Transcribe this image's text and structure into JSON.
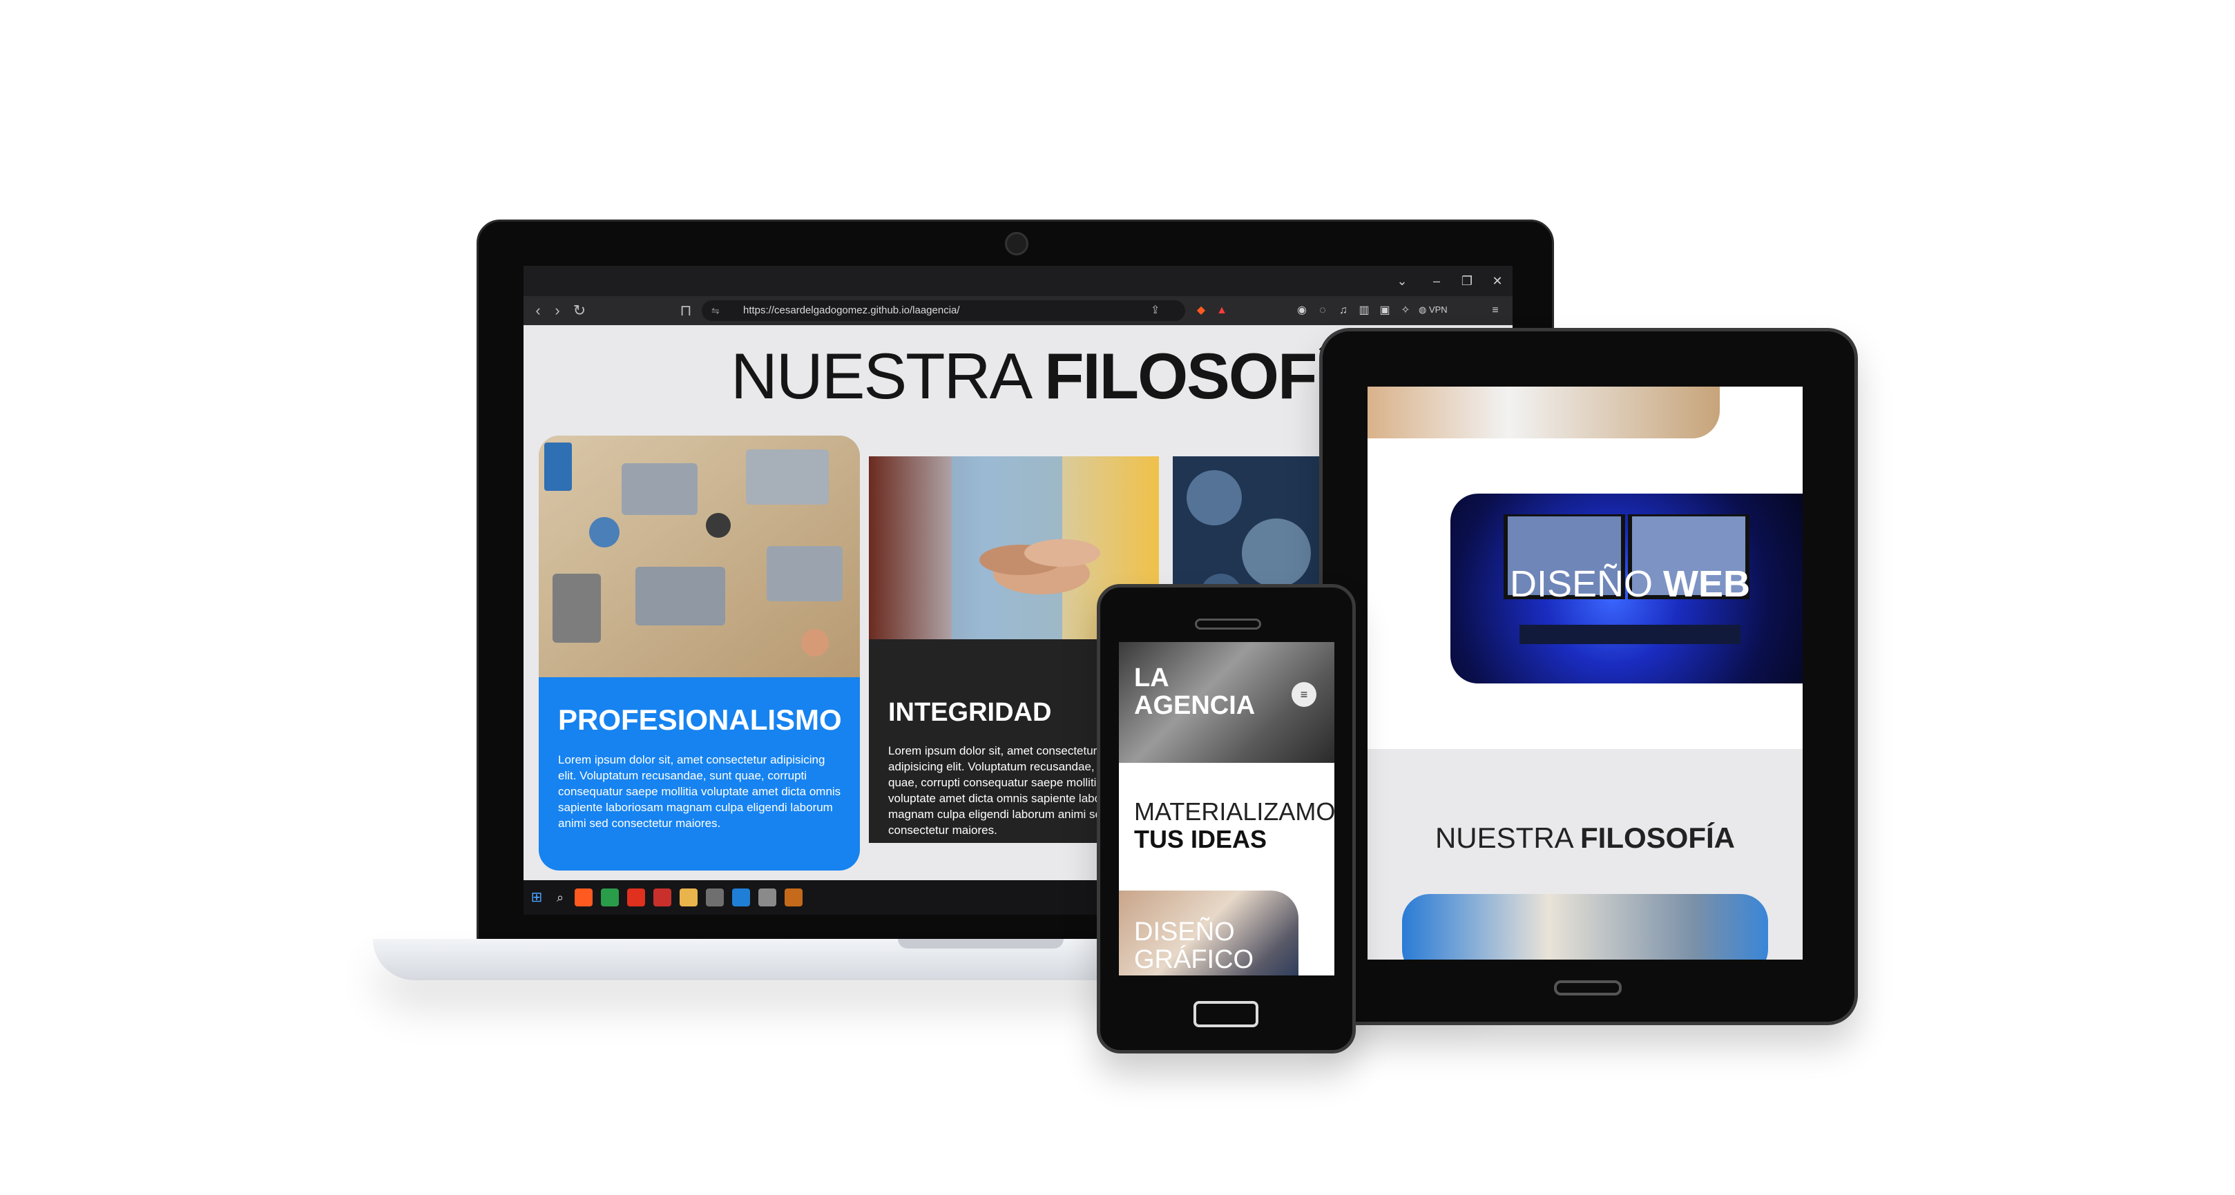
{
  "laptop": {
    "browser": {
      "url": "https://cesardelgadogomez.github.io/laagencia/",
      "vpn_label": "VPN"
    },
    "page": {
      "title_light": "NUESTRA",
      "title_bold": "FILOSOFÍA",
      "cards": [
        {
          "title": "PROFESIONALISMO",
          "text": "Lorem ipsum dolor sit, amet consectetur adipisicing elit. Voluptatum recusandae, sunt quae, corrupti consequatur saepe mollitia voluptate amet dicta omnis sapiente laboriosam magnam culpa eligendi laborum animi sed consectetur maiores.",
          "color": "#1683f0"
        },
        {
          "title": "INTEGRIDAD",
          "text": "Lorem ipsum dolor sit, amet consectetur adipisicing elit. Voluptatum recusandae, sunt quae, corrupti consequatur saepe mollitia voluptate amet dicta omnis sapiente laboriosam magnam culpa eligendi laborum animi sed consectetur maiores.",
          "color": "#232323"
        }
      ]
    }
  },
  "tablet": {
    "web_title_light": "DISEÑO",
    "web_title_bold": "WEB",
    "philo_light": "NUESTRA",
    "philo_bold": "FILOSOFÍA"
  },
  "phone": {
    "hero_title_line1": "LA",
    "hero_title_line2": "AGENCIA",
    "menu_icon": "≡",
    "tagline_light": "MATERIALIZAMOS",
    "tagline_bold": "TUS IDEAS",
    "diseno_line1": "DISEÑO",
    "diseno_line2": "GRÁFICO"
  }
}
